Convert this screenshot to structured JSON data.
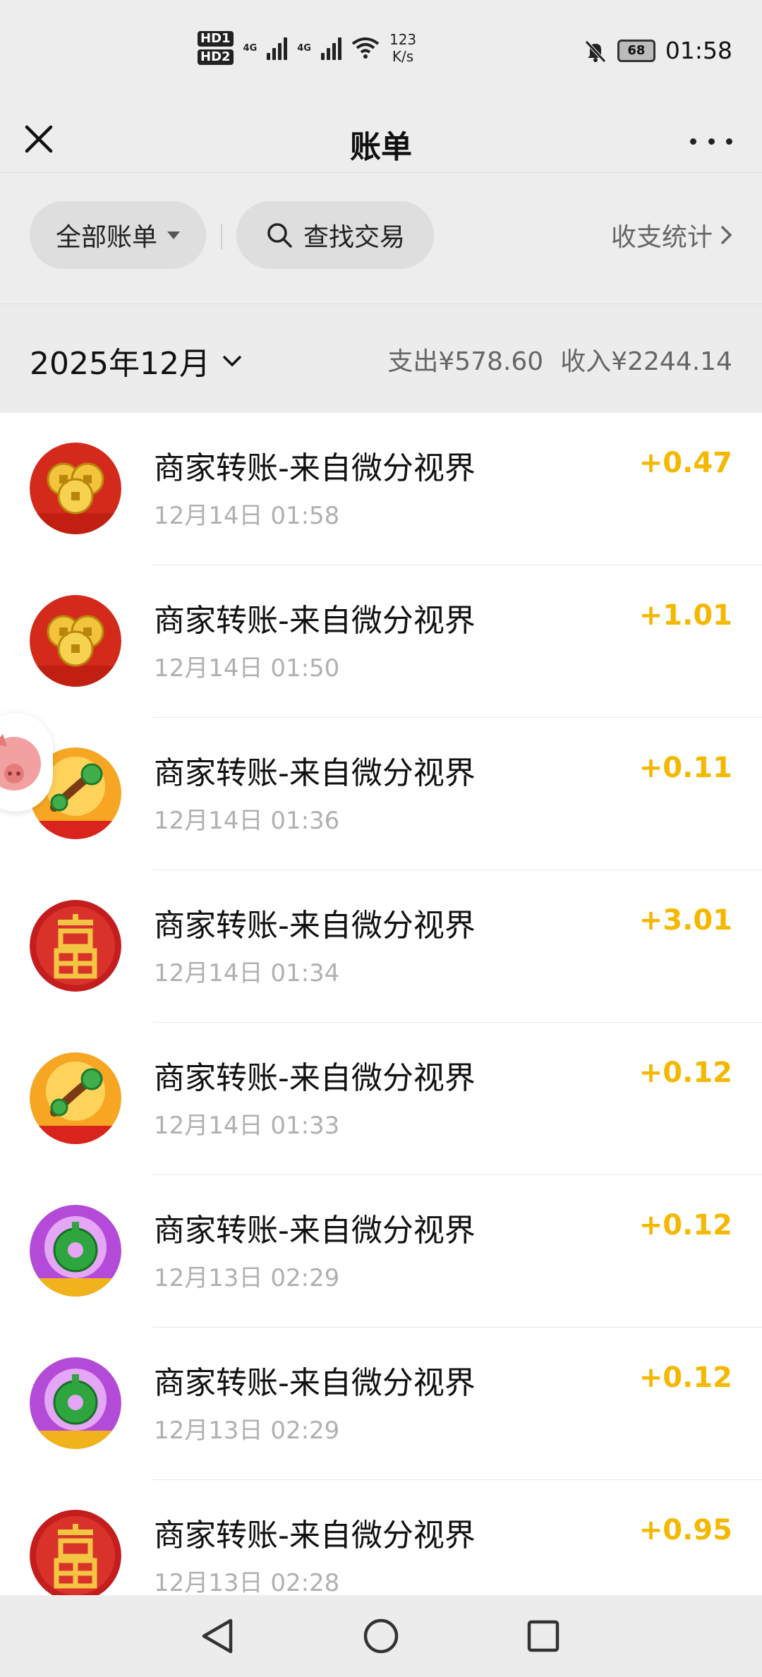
{
  "status_bar": {
    "hd1": "HD1",
    "hd2": "HD2",
    "network1": "4G",
    "network2": "4G",
    "speed_value": "123",
    "speed_unit": "K/s",
    "battery": "68",
    "time": "01:58"
  },
  "header": {
    "title": "账单"
  },
  "toolbar": {
    "filter_label": "全部账单",
    "search_label": "查找交易",
    "stats_label": "收支统计"
  },
  "month_bar": {
    "month": "2025年12月",
    "expense": "支出¥578.60",
    "income": "收入¥2244.14"
  },
  "transactions": [
    {
      "title": "商家转账-来自微分视界",
      "time": "12月14日 01:58",
      "amount": "+0.47",
      "icon": "coins-2025-icon"
    },
    {
      "title": "商家转账-来自微分视界",
      "time": "12月14日 01:50",
      "amount": "+1.01",
      "icon": "coins-2025-icon"
    },
    {
      "title": "商家转账-来自微分视界",
      "time": "12月14日 01:36",
      "amount": "+0.11",
      "icon": "jade-ruyi-icon"
    },
    {
      "title": "商家转账-来自微分视界",
      "time": "12月14日 01:34",
      "amount": "+3.01",
      "icon": "fu-character-icon"
    },
    {
      "title": "商家转账-来自微分视界",
      "time": "12月14日 01:33",
      "amount": "+0.12",
      "icon": "jade-ruyi-icon"
    },
    {
      "title": "商家转账-来自微分视界",
      "time": "12月13日 02:29",
      "amount": "+0.12",
      "icon": "jade-ring-icon"
    },
    {
      "title": "商家转账-来自微分视界",
      "time": "12月13日 02:29",
      "amount": "+0.12",
      "icon": "jade-ring-icon"
    },
    {
      "title": "商家转账-来自微分视界",
      "time": "12月13日 02:28",
      "amount": "+0.95",
      "icon": "fu-character-icon"
    }
  ],
  "colors": {
    "amount": "#f5b800",
    "background": "#ededed"
  }
}
